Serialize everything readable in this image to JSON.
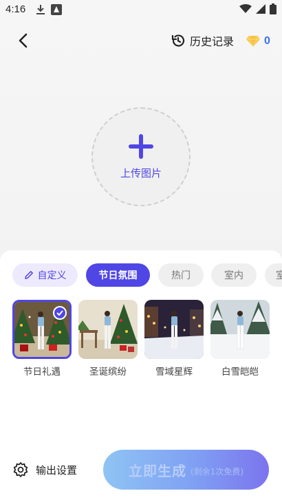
{
  "status_bar": {
    "time": "4:16"
  },
  "header": {
    "history_label": "历史记录",
    "gem_count": "0"
  },
  "upload": {
    "label": "上传图片"
  },
  "tabs": [
    {
      "label": "自定义",
      "icon": "pencil-icon"
    },
    {
      "label": "节日氛围"
    },
    {
      "label": "热门"
    },
    {
      "label": "室内"
    },
    {
      "label": "室"
    }
  ],
  "styles": [
    {
      "label": "节日礼遇",
      "selected": true
    },
    {
      "label": "圣诞缤纷",
      "selected": false
    },
    {
      "label": "雪域星辉",
      "selected": false
    },
    {
      "label": "白雪皑皑",
      "selected": false
    }
  ],
  "footer": {
    "settings_label": "输出设置",
    "generate_label": "立即生成",
    "generate_sub": "(剩余1次免费)"
  },
  "colors": {
    "accent": "#4f46e5",
    "gem": "#f6c343",
    "count": "#3b6ff0"
  }
}
